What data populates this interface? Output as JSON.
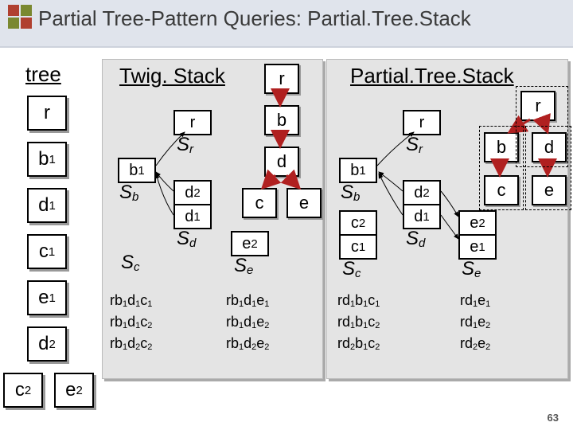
{
  "title": "Partial Tree-Pattern Queries: Partial.Tree.Stack",
  "left": {
    "heading": "tree",
    "nodes": [
      "r",
      "b_1",
      "d_1",
      "c_1",
      "e_1",
      "d_2",
      "c_2",
      "e_2"
    ]
  },
  "middle": {
    "heading": "Twig. Stack",
    "stacks": {
      "Sr": {
        "label": "S_r",
        "items": [
          "r"
        ]
      },
      "Sb": {
        "label": "S_b",
        "items": [
          "b_1"
        ]
      },
      "Sd": {
        "label": "S_d",
        "items": [
          "d_2",
          "d_1"
        ]
      },
      "Sc": {
        "label": "S_c",
        "items": []
      },
      "Se": {
        "label": "S_e",
        "items": [
          "e_2"
        ]
      }
    },
    "results_left": [
      "rb_1d_1c_1",
      "rb_1d_1c_2",
      "rb_1d_2c_2"
    ],
    "results_right": [
      "rb_1d_1e_1",
      "rb_1d_1e_2",
      "rb_1d_2e_2"
    ],
    "query_tree": {
      "root": "r",
      "child": "b",
      "gchild": "d",
      "gg": [
        "c",
        "e"
      ]
    }
  },
  "right": {
    "heading": "Partial.Tree.Stack",
    "stacks": {
      "Sr": {
        "label": "S_r",
        "items": [
          "r"
        ]
      },
      "Sb": {
        "label": "S_b",
        "items": [
          "b_1"
        ]
      },
      "Sd": {
        "label": "S_d",
        "items": [
          "d_2",
          "d_1"
        ]
      },
      "Sc": {
        "label": "S_c",
        "items": [
          "c_2",
          "c_1"
        ]
      },
      "Se": {
        "label": "S_e",
        "items": [
          "e_2",
          "e_1"
        ]
      }
    },
    "results_left": [
      "rd_1b_1c_1",
      "rd_1b_1c_2",
      "rd_2b_1c_2"
    ],
    "results_right": [
      "rd_1e_1",
      "rd_1e_2",
      "rd_2e_2"
    ],
    "query_tree": {
      "root": "r",
      "children": [
        "b",
        "d"
      ],
      "b_child": "c",
      "d_child": "e"
    }
  },
  "page": "63"
}
